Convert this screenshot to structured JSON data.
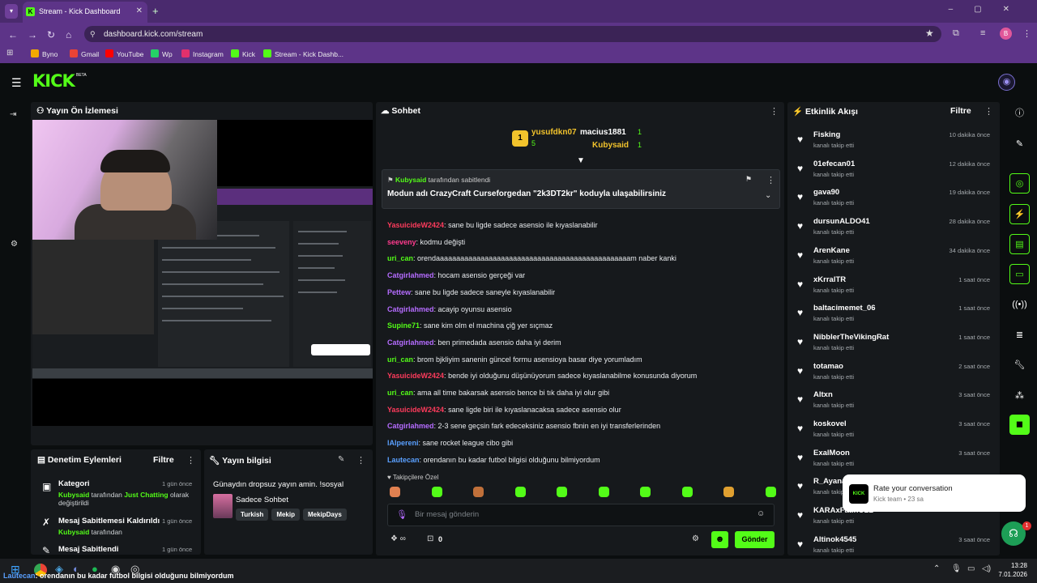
{
  "browser": {
    "tab_title": "Stream - Kick Dashboard",
    "url": "dashboard.kick.com/stream",
    "profile_initial": "B",
    "bookmarks": [
      {
        "label": "Byno",
        "color": "#f2a900"
      },
      {
        "label": "Gmail",
        "color": "#ea4335"
      },
      {
        "label": "YouTube",
        "color": "#ff0000"
      },
      {
        "label": "Wp",
        "color": "#25d366"
      },
      {
        "label": "Instagram",
        "color": "#e1306c"
      },
      {
        "label": "Kick",
        "color": "#53fc18"
      },
      {
        "label": "Stream - Kick Dashb...",
        "color": "#53fc18"
      }
    ]
  },
  "header": {
    "logo": "KICK",
    "beta": "BETA"
  },
  "preview": {
    "title": "Yayın Ön İzlemesi"
  },
  "moderation": {
    "title": "Denetim Eylemleri",
    "filter": "Filtre",
    "items": [
      {
        "title": "Kategori",
        "time": "1 gün önce",
        "user": "Kubysaid",
        "mid": " tarafından ",
        "value": "Just Chatting",
        "tail": " olarak değiştirildi"
      },
      {
        "title": "Mesaj Sabitlemesi Kaldırıldı",
        "time": "1 gün önce",
        "user": "Kubysaid",
        "mid": " tarafından"
      },
      {
        "title": "Mesaj Sabitlendi",
        "time": "1 gün önce"
      }
    ]
  },
  "stream_info": {
    "title": "Yayın bilgisi",
    "stream_title": "Günaydın dropsuz yayın amin. !sosyal",
    "category": "Sadece Sohbet",
    "tags": [
      "Turkish",
      "Mekip",
      "MekipDays"
    ]
  },
  "chat": {
    "title": "Sohbet",
    "leaders": [
      {
        "rank": "1",
        "name": "yusufdkn07",
        "count": "5"
      },
      {
        "name": "macius1881",
        "count": "1"
      },
      {
        "name": "Kubysaid",
        "count": "1"
      }
    ],
    "pinned": {
      "by": "Kubysaid",
      "by_suffix": " tarafından sabitlendi",
      "text": "Modun adı CrazyCraft Curseforgedan \"2k3DT2kr\" koduyla ulaşabilirsiniz"
    },
    "messages": [
      {
        "user": "YasuicideW2424",
        "color": "#ff3b5c",
        "text": "sane bu ligde sadece asensio ile kıyaslanabilir"
      },
      {
        "user": "seeveny",
        "color": "#ff3b8e",
        "text": "kodmu değişti"
      },
      {
        "user": "uri_can",
        "color": "#53fc18",
        "text": "orendaaaaaaaaaaaaaaaaaaaaaaaaaaaaaaaaaaaaaaaaaaaaaaaam naber kanki"
      },
      {
        "user": "Catgirlahmed",
        "color": "#b56cff",
        "text": "hocam asensio gerçeği var"
      },
      {
        "user": "Pettew",
        "color": "#b56cff",
        "text": "sane bu ligde sadece saneyle kıyaslanabilir"
      },
      {
        "user": "Catgirlahmed",
        "color": "#b56cff",
        "text": "acayip oyunsu asensio"
      },
      {
        "user": "Supine71",
        "color": "#53fc18",
        "text": "sane kim olm el machina çiğ yer sıçmaz"
      },
      {
        "user": "Catgirlahmed",
        "color": "#b56cff",
        "text": "ben primedada asensio daha iyi derim"
      },
      {
        "user": "uri_can",
        "color": "#53fc18",
        "text": "brom bjkliyim sanenin güncel formu asensioya basar diye yorumladım"
      },
      {
        "user": "YasuicideW2424",
        "color": "#ff3b5c",
        "text": "bende iyi olduğunu düşünüyorum sadece kıyaslanabilme konusunda diyorum"
      },
      {
        "user": "uri_can",
        "color": "#53fc18",
        "text": "ama all time bakarsak asensio bence bi tık daha iyi olur gibi"
      },
      {
        "user": "YasuicideW2424",
        "color": "#ff3b5c",
        "text": "sane ligde biri ile kıyaslanacaksa sadece asensio olur"
      },
      {
        "user": "Catgirlahmed",
        "color": "#b56cff",
        "text": "2-3 sene geçsin fark edeceksiniz asensio fbnin en iyi transferlerinden"
      },
      {
        "user": "lAlpereni",
        "color": "#5aa0ff",
        "text": "sane rocket league cibo gibi"
      },
      {
        "user": "Lautecan",
        "color": "#5aa0ff",
        "text": "orendanın bu kadar futbol bilgisi olduğunu bilmiyordum"
      }
    ],
    "emote_label": "Takipçilere Özel",
    "input_placeholder": "Bir mesaj gönderin",
    "points": "0",
    "send": "Gönder"
  },
  "activity": {
    "title": "Etkinlik Akışı",
    "filter": "Filtre",
    "subtitle": "kanalı takip etti",
    "items": [
      {
        "name": "Fisking",
        "time": "10 dakika önce"
      },
      {
        "name": "01efecan01",
        "time": "12 dakika önce"
      },
      {
        "name": "gava90",
        "time": "19 dakika önce"
      },
      {
        "name": "dursunALDO41",
        "time": "28 dakika önce"
      },
      {
        "name": "ArenKane",
        "time": "34 dakika önce"
      },
      {
        "name": "xKrralTR",
        "time": "1 saat önce"
      },
      {
        "name": "baltacimemet_06",
        "time": "1 saat önce"
      },
      {
        "name": "NibblerTheVikingRat",
        "time": "1 saat önce"
      },
      {
        "name": "totamao",
        "time": "2 saat önce"
      },
      {
        "name": "Altxn",
        "time": "3 saat önce"
      },
      {
        "name": "koskovel",
        "time": "3 saat önce"
      },
      {
        "name": "ExalMoon",
        "time": "3 saat önce"
      },
      {
        "name": "R_Ayana",
        "time": ""
      },
      {
        "name": "KARAxFatihO2L",
        "time": ""
      },
      {
        "name": "Altinok4545",
        "time": "3 saat önce"
      }
    ]
  },
  "toast": {
    "title": "Rate your conversation",
    "sub": "Kick team • 23 sa"
  },
  "help_badge": "1",
  "taskbar": {
    "note_user": "Lautecan",
    "note_text": ": orendanın bu kadar futbol bilgisi olduğunu bilmiyordum",
    "time": "13:28",
    "date": "7.01.2026"
  }
}
